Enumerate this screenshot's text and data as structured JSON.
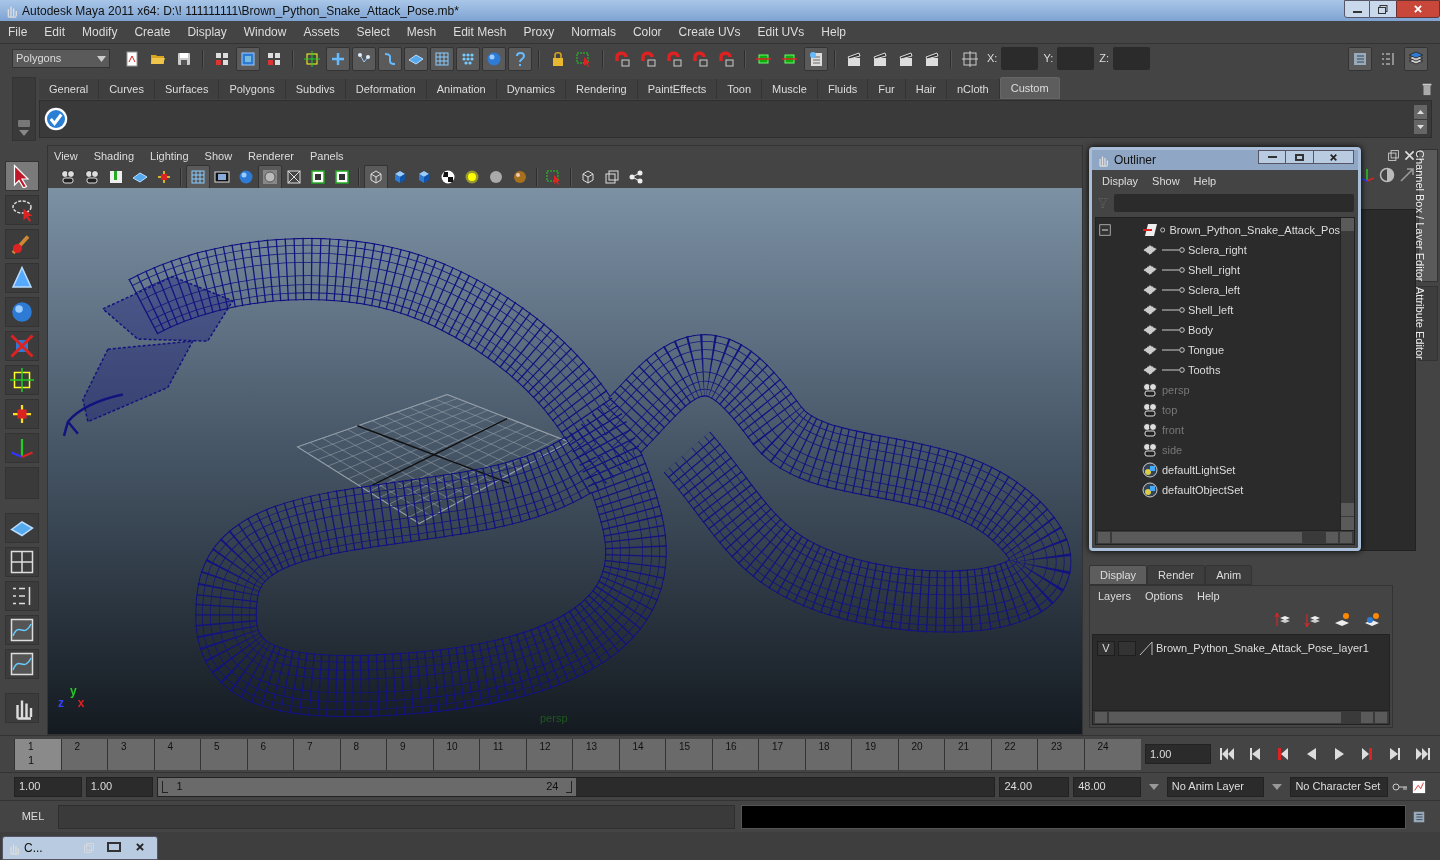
{
  "window": {
    "title": "Autodesk Maya 2011 x64: D:\\! 111111111\\Brown_Python_Snake_Attack_Pose.mb*"
  },
  "menu": [
    "File",
    "Edit",
    "Modify",
    "Create",
    "Display",
    "Window",
    "Assets",
    "Select",
    "Mesh",
    "Edit Mesh",
    "Proxy",
    "Normals",
    "Color",
    "Create UVs",
    "Edit UVs",
    "Help"
  ],
  "status_line": {
    "mode": "Polygons",
    "coords": [
      "X:",
      "Y:",
      "Z:"
    ]
  },
  "shelf": {
    "tabs": [
      {
        "label": "General",
        "selected": false
      },
      {
        "label": "Curves",
        "selected": false
      },
      {
        "label": "Surfaces",
        "selected": false
      },
      {
        "label": "Polygons",
        "selected": false
      },
      {
        "label": "Subdivs",
        "selected": false
      },
      {
        "label": "Deformation",
        "selected": false
      },
      {
        "label": "Animation",
        "selected": false
      },
      {
        "label": "Dynamics",
        "selected": false
      },
      {
        "label": "Rendering",
        "selected": false
      },
      {
        "label": "PaintEffects",
        "selected": false
      },
      {
        "label": "Toon",
        "selected": false
      },
      {
        "label": "Muscle",
        "selected": false
      },
      {
        "label": "Fluids",
        "selected": false
      },
      {
        "label": "Fur",
        "selected": false
      },
      {
        "label": "Hair",
        "selected": false
      },
      {
        "label": "nCloth",
        "selected": false
      },
      {
        "label": "Custom",
        "selected": true
      }
    ]
  },
  "viewport": {
    "menu": [
      "View",
      "Shading",
      "Lighting",
      "Show",
      "Renderer",
      "Panels"
    ],
    "camera_label": "persp",
    "axes": [
      {
        "label": "y",
        "color": "#22cc22"
      },
      {
        "label": "z",
        "color": "#3344ff"
      },
      {
        "label": "x",
        "color": "#dd2222"
      }
    ]
  },
  "outliner": {
    "title": "Outliner",
    "menu": [
      "Display",
      "Show",
      "Help"
    ],
    "tree": [
      {
        "label": "Brown_Python_Snake_Attack_Pos",
        "kind": "group",
        "dimmed": false,
        "expanded": true,
        "children": [
          {
            "label": "Sclera_right",
            "kind": "mesh",
            "dimmed": false
          },
          {
            "label": "Shell_right",
            "kind": "mesh",
            "dimmed": false
          },
          {
            "label": "Sclera_left",
            "kind": "mesh",
            "dimmed": false
          },
          {
            "label": "Shell_left",
            "kind": "mesh",
            "dimmed": false
          },
          {
            "label": "Body",
            "kind": "mesh",
            "dimmed": false
          },
          {
            "label": "Tongue",
            "kind": "mesh",
            "dimmed": false
          },
          {
            "label": "Tooths",
            "kind": "mesh",
            "dimmed": false
          }
        ]
      },
      {
        "label": "persp",
        "kind": "camera",
        "dimmed": true
      },
      {
        "label": "top",
        "kind": "camera",
        "dimmed": true
      },
      {
        "label": "front",
        "kind": "camera",
        "dimmed": true
      },
      {
        "label": "side",
        "kind": "camera",
        "dimmed": true
      },
      {
        "label": "defaultLightSet",
        "kind": "set",
        "dimmed": false
      },
      {
        "label": "defaultObjectSet",
        "kind": "set",
        "dimmed": false
      }
    ]
  },
  "side_tabs": [
    "Channel Box / Layer Editor",
    "Attribute Editor"
  ],
  "layer_editor": {
    "tabs": [
      {
        "label": "Display",
        "selected": true
      },
      {
        "label": "Render",
        "selected": false
      },
      {
        "label": "Anim",
        "selected": false
      }
    ],
    "menu": [
      "Layers",
      "Options",
      "Help"
    ],
    "layers": [
      {
        "visibility": "V",
        "name": "Brown_Python_Snake_Attack_Pose_layer1"
      }
    ]
  },
  "timeline": {
    "ticks": [
      {
        "label": "1",
        "selected": true
      },
      {
        "label": "2",
        "selected": false
      },
      {
        "label": "3",
        "selected": false
      },
      {
        "label": "4",
        "selected": false
      },
      {
        "label": "5",
        "selected": false
      },
      {
        "label": "6",
        "selected": false
      },
      {
        "label": "7",
        "selected": false
      },
      {
        "label": "8",
        "selected": false
      },
      {
        "label": "9",
        "selected": false
      },
      {
        "label": "10",
        "selected": false
      },
      {
        "label": "11",
        "selected": false
      },
      {
        "label": "12",
        "selected": false
      },
      {
        "label": "13",
        "selected": false
      },
      {
        "label": "14",
        "selected": false
      },
      {
        "label": "15",
        "selected": false
      },
      {
        "label": "16",
        "selected": false
      },
      {
        "label": "17",
        "selected": false
      },
      {
        "label": "18",
        "selected": false
      },
      {
        "label": "19",
        "selected": false
      },
      {
        "label": "20",
        "selected": false
      },
      {
        "label": "21",
        "selected": false
      },
      {
        "label": "22",
        "selected": false
      },
      {
        "label": "23",
        "selected": false
      },
      {
        "label": "24",
        "selected": false
      }
    ],
    "current_frame": "1",
    "current_time": "1.00"
  },
  "range": {
    "level": 0.5,
    "start": "1.00",
    "playback_start": "1.00",
    "slider_start": "1",
    "slider_end": "24",
    "playback_end": "24.00",
    "end": "48.00",
    "anim_layer": "No Anim Layer",
    "character_set": "No Character Set"
  },
  "command_line": {
    "label": "MEL"
  },
  "minimized_window": {
    "title": "C..."
  }
}
